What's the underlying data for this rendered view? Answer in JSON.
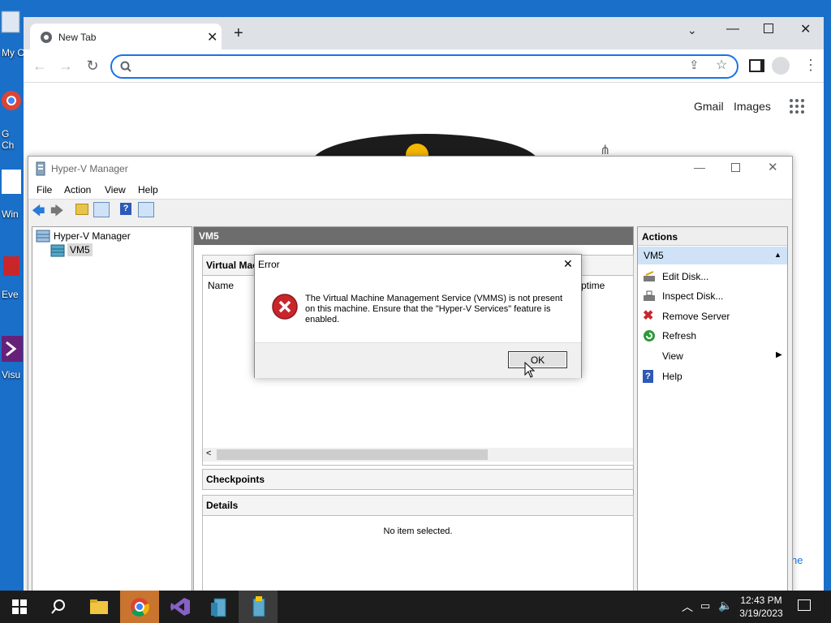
{
  "desktop": {
    "icons": [
      {
        "label": "My C",
        "name": "recycle-bin"
      },
      {
        "label": "G",
        "name": "chrome-shortcut"
      },
      {
        "label": "Ch",
        "name": "chrome-shortcut-2"
      },
      {
        "label": "Win",
        "name": "windows-shortcut"
      },
      {
        "label": "Eve",
        "name": "event-shortcut"
      },
      {
        "label": "Visu",
        "name": "visual-studio-shortcut"
      }
    ]
  },
  "chrome": {
    "tab_title": "New Tab",
    "search_placeholder": "",
    "links": {
      "gmail": "Gmail",
      "images": "Images"
    },
    "partial_text": "ne"
  },
  "hyperv": {
    "title": "Hyper-V Manager",
    "menu": [
      "File",
      "Action",
      "View",
      "Help"
    ],
    "tree": {
      "root": "Hyper-V Manager",
      "child": "VM5"
    },
    "center": {
      "header": "VM5",
      "vm_section": "Virtual Mac",
      "columns": {
        "name": "Name",
        "uptime": "ptime"
      },
      "checkpoints": "Checkpoints",
      "details": "Details",
      "no_item": "No item selected."
    },
    "actions": {
      "header": "Actions",
      "group": "VM5",
      "items": [
        "Edit Disk...",
        "Inspect Disk...",
        "Remove Server",
        "Refresh",
        "View",
        "Help"
      ]
    }
  },
  "dialog": {
    "title": "Error",
    "message": "The Virtual Machine Management Service (VMMS) is not present on this machine.  Ensure that the \"Hyper-V Services\" feature is enabled.",
    "ok_label": "OK"
  },
  "taskbar": {
    "time": "12:43 PM",
    "date": "3/19/2023"
  },
  "colors": {
    "desktop": "#1a6fc9",
    "accent": "#1a73e8",
    "error_red": "#c8262b",
    "selection": "#cfe2f8"
  }
}
